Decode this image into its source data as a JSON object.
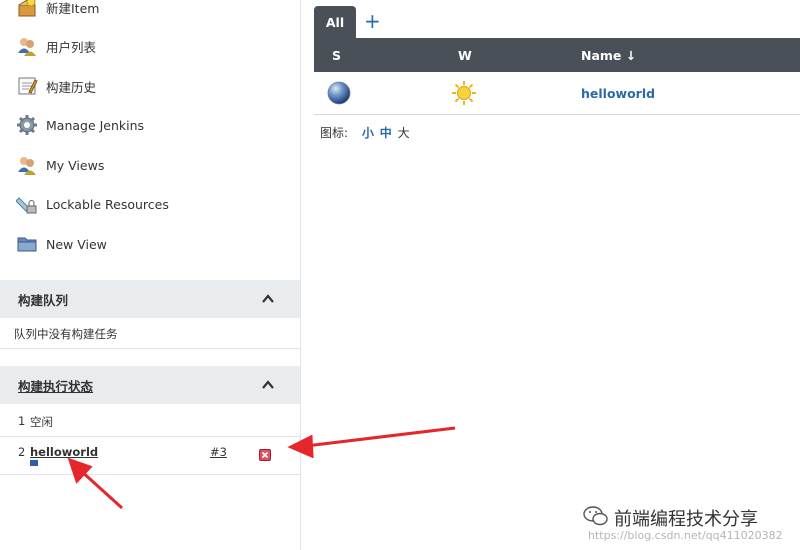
{
  "sidebar": {
    "tasks": [
      {
        "label": "新建Item",
        "icon": "new-item-icon"
      },
      {
        "label": "用户列表",
        "icon": "users-icon"
      },
      {
        "label": "构建历史",
        "icon": "notepad-icon"
      },
      {
        "label": "Manage Jenkins",
        "icon": "gear-icon"
      },
      {
        "label": "My Views",
        "icon": "users-icon"
      },
      {
        "label": "Lockable Resources",
        "icon": "lock-resources-icon"
      },
      {
        "label": "New View",
        "icon": "folder-icon"
      }
    ],
    "build_queue": {
      "title": "构建队列",
      "empty_text": "队列中没有构建任务"
    },
    "executor_status": {
      "title": "构建执行状态",
      "rows": [
        {
          "num": "1",
          "status": "空闲"
        },
        {
          "num": "2",
          "job": "helloworld",
          "build": "#3"
        }
      ]
    }
  },
  "main": {
    "tabs": [
      {
        "label": "All"
      }
    ],
    "add_tab_label": "+",
    "columns": {
      "s": "S",
      "w": "W",
      "name": "Name ↓"
    },
    "jobs": [
      {
        "name": "helloworld",
        "status_color": "blue",
        "weather": "sunny"
      }
    ],
    "icon_size": {
      "label": "图标:",
      "sizes": [
        "小",
        "中",
        "大"
      ],
      "current": "大"
    }
  },
  "watermark": {
    "brand": "前端编程技术分享",
    "url": "https://blog.csdn.net/qq411020382"
  },
  "colors": {
    "header_bg": "#4a5058",
    "link": "#2b6aa8",
    "section_bg": "#e9ecee",
    "annotation_arrow": "#e5262a"
  }
}
